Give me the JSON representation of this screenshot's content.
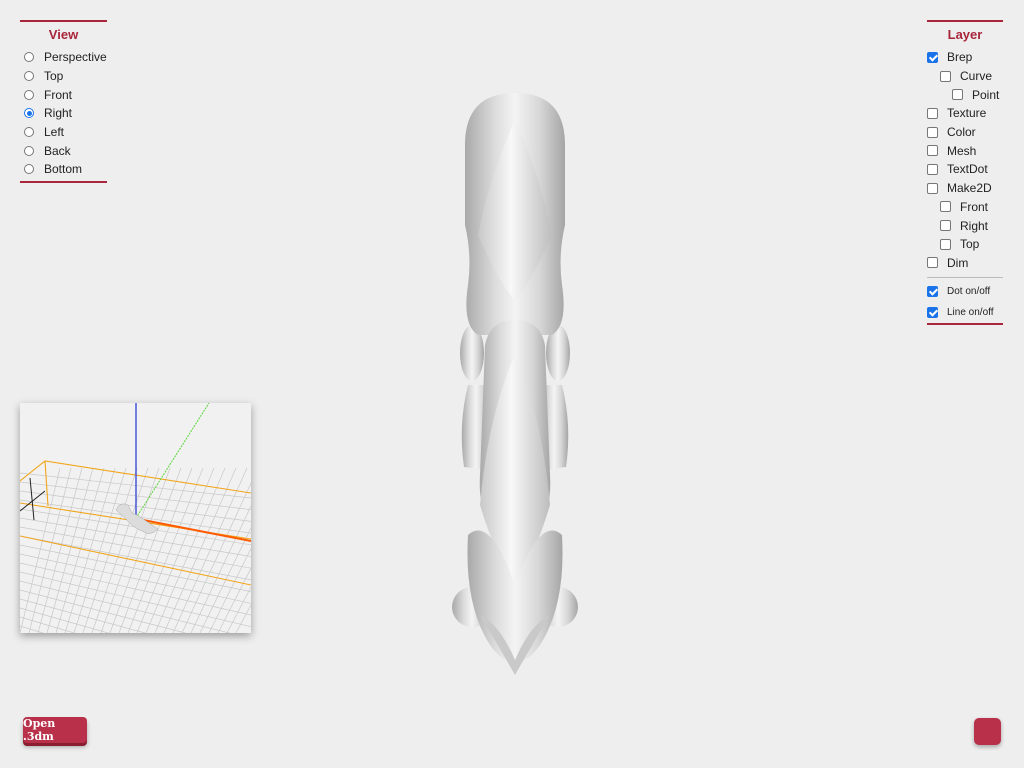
{
  "view_panel": {
    "title": "View",
    "options": [
      {
        "label": "Perspective",
        "selected": false
      },
      {
        "label": "Top",
        "selected": false
      },
      {
        "label": "Front",
        "selected": false
      },
      {
        "label": "Right",
        "selected": true
      },
      {
        "label": "Left",
        "selected": false
      },
      {
        "label": "Back",
        "selected": false
      },
      {
        "label": "Bottom",
        "selected": false
      }
    ]
  },
  "layer_panel": {
    "title": "Layer",
    "items": [
      {
        "label": "Brep",
        "checked": true,
        "indent": 0
      },
      {
        "label": "Curve",
        "checked": false,
        "indent": 1
      },
      {
        "label": "Point",
        "checked": false,
        "indent": 2
      },
      {
        "label": "Texture",
        "checked": false,
        "indent": 0
      },
      {
        "label": "Color",
        "checked": false,
        "indent": 0
      },
      {
        "label": "Mesh",
        "checked": false,
        "indent": 0
      },
      {
        "label": "TextDot",
        "checked": false,
        "indent": 0
      },
      {
        "label": "Make2D",
        "checked": false,
        "indent": 0
      },
      {
        "label": "Front",
        "checked": false,
        "indent": 1
      },
      {
        "label": "Right",
        "checked": false,
        "indent": 1
      },
      {
        "label": "Top",
        "checked": false,
        "indent": 1
      },
      {
        "label": "Dim",
        "checked": false,
        "indent": 0
      }
    ],
    "toggles": [
      {
        "label": "Dot on/off",
        "checked": true
      },
      {
        "label": "Line on/off",
        "checked": true
      }
    ]
  },
  "buttons": {
    "open_label": "Open .3dm"
  },
  "colors": {
    "accent": "#a8263a",
    "button": "#b8304a",
    "checkbox": "#1a73e8",
    "background": "#eeeeee"
  }
}
